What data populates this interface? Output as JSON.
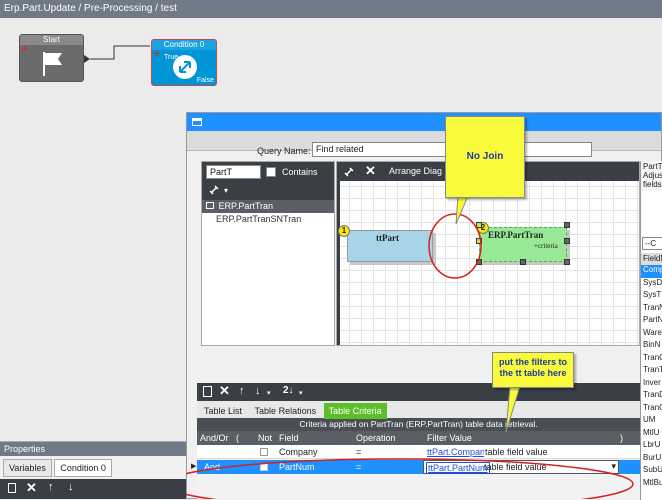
{
  "workflow": {
    "title": "Erp.Part.Update / Pre-Processing / test",
    "start_label": "Start",
    "condition_label": "Condition 0",
    "true_label": "True",
    "false_label": "False"
  },
  "query": {
    "name_label": "Query Name:",
    "name_value": "Find related"
  },
  "table_list": {
    "search_value": "PartT",
    "contains_label": "Contains",
    "items": [
      "ERP.PartTran",
      "ERP.PartTranSNTran"
    ]
  },
  "diagram": {
    "arrange_label": "Arrange Diag",
    "table1": {
      "number": "1",
      "name": "ttPart"
    },
    "table2": {
      "number": "2",
      "name": "ERP.PartTran",
      "sub": "+criteria"
    }
  },
  "callouts": {
    "no_join": "No Join",
    "filters": "put the filters to the tt table here"
  },
  "tabs": [
    "Table List",
    "Table Relations",
    "Table Criteria"
  ],
  "criteria": {
    "caption": "Criteria applied on PartTran (ERP.PartTran)  table data retrieval.",
    "headers": [
      "And/Or",
      "(",
      "Not",
      "Field",
      "Operation",
      "Filter Value",
      ")"
    ],
    "rows": [
      {
        "andor": "",
        "field": "Company",
        "operation": "=",
        "link": "ttPart.Company",
        "value": "table field value"
      },
      {
        "andor": "And",
        "field": "PartNum",
        "operation": "=",
        "link": "ttPart.PartNum",
        "value": "table field value"
      }
    ]
  },
  "right_panel": {
    "desc": [
      "PartT",
      "Adjus",
      "fields"
    ],
    "dropdown": "--C",
    "header": "FieldN",
    "fields": [
      "Comp",
      "SysD",
      "SysT",
      "TranN",
      "PartN",
      "Ware",
      "BinN",
      "TranC",
      "TranT",
      "Inver",
      "TranD",
      "TranC",
      "UM",
      "MtlU",
      "LbrU",
      "BurU",
      "SubU",
      "MtlBu"
    ]
  },
  "properties": {
    "title": "Properties",
    "tabs": [
      "Variables",
      "Condition 0"
    ]
  },
  "colors": {
    "accent": "#1e90ff",
    "callout": "#fafa3c",
    "annotation": "#d62020",
    "table2_fill": "#98e898",
    "table1_fill": "#a8d4e8"
  }
}
